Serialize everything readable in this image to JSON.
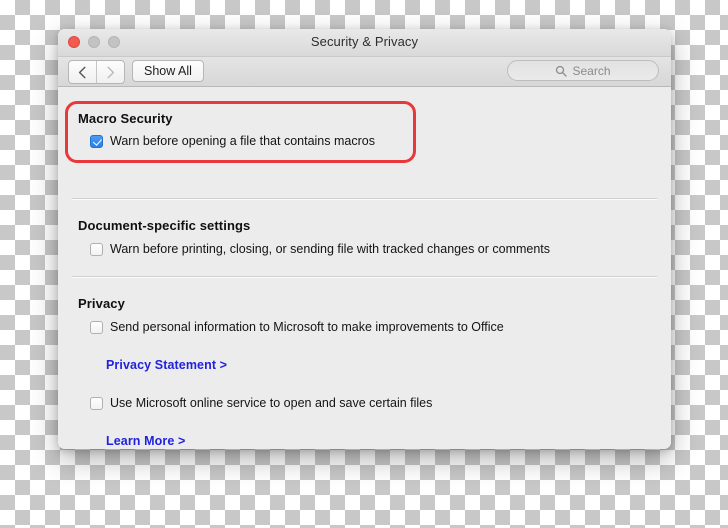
{
  "window": {
    "title": "Security & Privacy",
    "traffic_lights": {
      "close": "close-button",
      "minimize": "minimize-button",
      "maximize": "maximize-button"
    }
  },
  "toolbar": {
    "back_label": "‹",
    "forward_label": "›",
    "show_all_label": "Show All",
    "search_placeholder": "Search",
    "search_value": ""
  },
  "sections": {
    "macro_security": {
      "title": "Macro Security",
      "highlighted": true,
      "highlight_color": "#e8383a",
      "checkbox": {
        "label": "Warn before opening a file that contains macros",
        "checked": true
      }
    },
    "document_specific": {
      "title": "Document-specific settings",
      "checkbox": {
        "label": "Warn before printing, closing, or sending file with tracked changes or comments",
        "checked": false
      }
    },
    "privacy": {
      "title": "Privacy",
      "checkbox_1": {
        "label": "Send personal information to Microsoft to make improvements to Office",
        "checked": false
      },
      "link_1": "Privacy Statement >",
      "checkbox_2": {
        "label": "Use Microsoft online service to open and save certain files",
        "checked": false
      },
      "link_2": "Learn More >"
    }
  },
  "colors": {
    "accent_blue": "#2b7fe8",
    "link_blue": "#2222dd",
    "highlight_red": "#e8383a",
    "window_bg": "#ececec"
  }
}
